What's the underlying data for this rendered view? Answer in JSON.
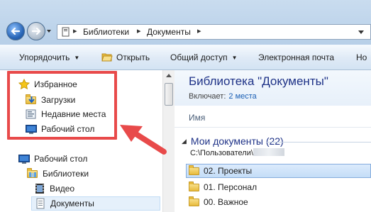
{
  "address_bar": {
    "crumbs": [
      "Библиотеки",
      "Документы"
    ],
    "separators": [
      "▸",
      "▸",
      "▸"
    ]
  },
  "toolbar": {
    "organize": "Упорядочить",
    "open": "Открыть",
    "share": "Общий доступ",
    "email": "Электронная почта",
    "new_folder_partial": "Но"
  },
  "nav": {
    "favorites": {
      "title": "Избранное",
      "items": [
        "Загрузки",
        "Недавние места",
        "Рабочий стол"
      ]
    },
    "tree": {
      "desktop": "Рабочий стол",
      "libraries": "Библиотеки",
      "video": "Видео",
      "documents": "Документы"
    }
  },
  "main": {
    "library_title": "Библиотека \"Документы\"",
    "includes_label": "Включает:",
    "includes_link": "2 места",
    "column_name": "Имя",
    "group_title": "Мои документы (22)",
    "group_path": "C:\\Пользователи\\",
    "files": [
      "02. Проекты",
      "01. Персонал",
      "00. Важное"
    ]
  },
  "colors": {
    "annotation": "#e84a4a",
    "title_blue": "#1e3287",
    "link_blue": "#1a5fb4"
  },
  "icons": [
    "back-arrow-icon",
    "forward-arrow-icon",
    "computer-icon",
    "open-folder-icon",
    "star-icon",
    "downloads-folder-icon",
    "recent-places-icon",
    "desktop-icon",
    "libraries-icon",
    "video-icon",
    "documents-icon",
    "folder-icon"
  ]
}
